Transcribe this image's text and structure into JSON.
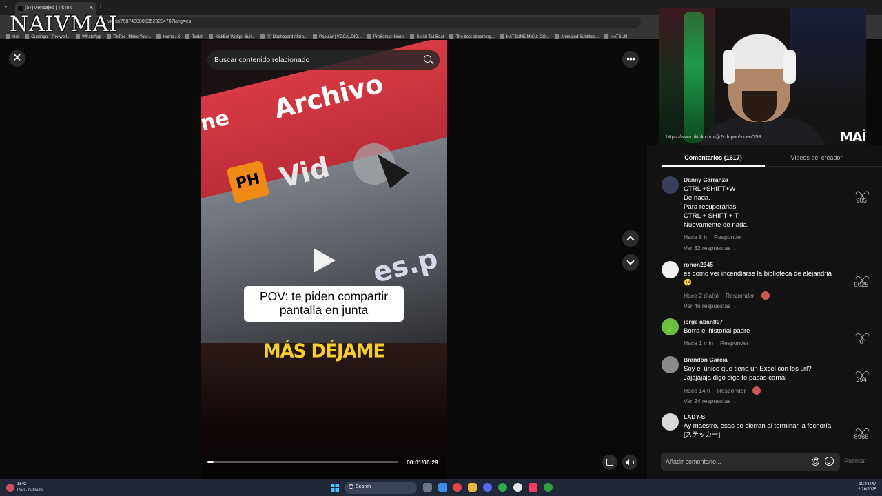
{
  "overlay_brand": "NAIVMAI",
  "browser": {
    "tab_title": "(57)Mensajes | TikTok",
    "url_visible": "video/7587430885352328478?lang=es",
    "bookmarks": [
      "Kick",
      "Duolingo - The worl...",
      "WhatsApp",
      "TikTok - Make Your...",
      "Home / X",
      "Twitch",
      "KickBot Widget Buil...",
      "(3) Dashboard / Stre...",
      "Popular | VOCALOID...",
      "PreSonus: Home",
      "Script Tail Beat",
      "The best streaming...",
      "HATSUNE MIKU: CO...",
      "Animated Subtitles...",
      "HATSUN"
    ]
  },
  "search": {
    "placeholder": "Buscar contenido relacionado"
  },
  "video": {
    "caption_line1": "POV: te piden compartir",
    "caption_line2": "pantalla en junta",
    "caption_secondary": "MÁS DÉJAME",
    "scene_words": {
      "archivo": "Archivo",
      "ne": "ne",
      "ph": "PH",
      "vid": "Vid",
      "esp": "es.p"
    },
    "time": "00:01/00:29",
    "progress": 0.034
  },
  "webcam": {
    "url_fragment": "https://www.tiktok.com/@2cdupou/video/758...",
    "logo": "MAİ"
  },
  "tabs": {
    "comments": "Comentarios (1617)",
    "creator_videos": "Videos del creador"
  },
  "comments": [
    {
      "user": "Danny Carranza",
      "lines": [
        "CTRL +SHIFT+W",
        "De nada.",
        "Para recuperarlas",
        "CTRL + SHIFT + T",
        "Nuevamente de nada."
      ],
      "time": "Hace 8 h",
      "reply": "Responder",
      "replies": "Ver 32 respuestas ⌄",
      "likes": "905",
      "avatar_color": "#3a3d5c",
      "avatar_letter": ""
    },
    {
      "user": "ronon2345",
      "lines": [
        "es como ver incendiarse la biblioteca de alejandria",
        "🥺"
      ],
      "time": "Hace 2 día(s)",
      "reply": "Responder",
      "replies": "Ver 46 respuestas ⌄",
      "likes": "9025",
      "avatar_color": "#f0f0f0",
      "avatar_letter": ""
    },
    {
      "user": "jorge aban807",
      "lines": [
        "Borra el historial padre"
      ],
      "time": "Hace 1 min",
      "reply": "Responder",
      "replies": "",
      "likes": "0",
      "avatar_color": "#6cbf3a",
      "avatar_letter": "j"
    },
    {
      "user": "Brandon Garcia",
      "lines": [
        "Soy el único que tiene un Excel con los url?",
        "Jajajajaja digo digo te pasas carnal"
      ],
      "time": "Hace 14 h",
      "reply": "Responder",
      "replies": "Ver 24 respuestas ⌄",
      "likes": "294",
      "avatar_color": "#8a8a8a",
      "avatar_letter": ""
    },
    {
      "user": "LADY-S",
      "lines": [
        "Ay maestro, esas se cierran al terminar la fechoría",
        "[ステッカー]"
      ],
      "time": "",
      "reply": "",
      "replies": "",
      "likes": "8965",
      "avatar_color": "#d9d9d9",
      "avatar_letter": ""
    }
  ],
  "comment_input": {
    "placeholder": "Añadir comentario...",
    "publish": "Publicar"
  },
  "taskbar": {
    "weather_temp": "15°C",
    "weather_desc": "Parc. nublado",
    "search": "Search",
    "time": "10:44 PM",
    "date": "12/26/2025"
  },
  "colors": {
    "accent_caption": "#f5cf2e",
    "tiktok_red": "#fe2c55"
  }
}
